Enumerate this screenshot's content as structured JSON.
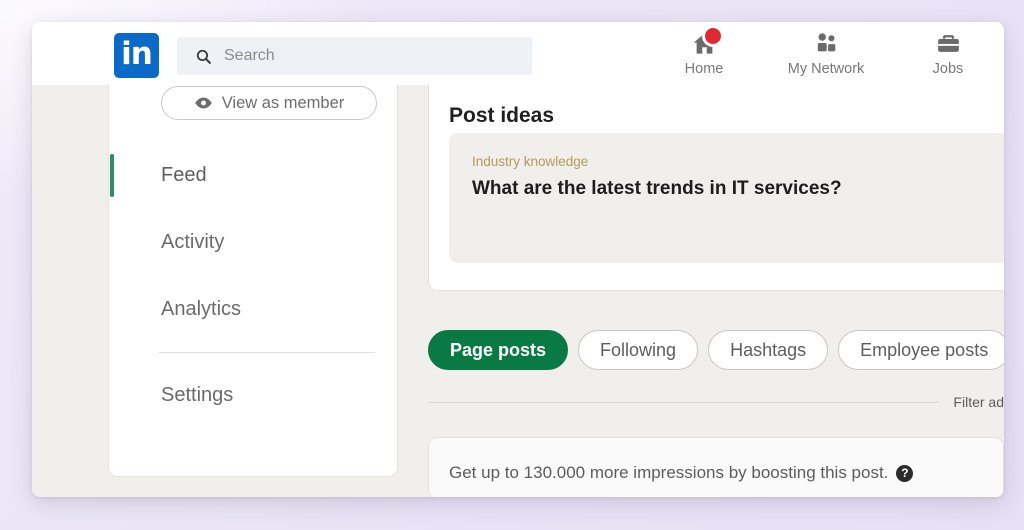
{
  "brand": {
    "logo_text": "in",
    "logo_color": "#0b69c7",
    "accent_green": "#0a7a45",
    "badge_red": "#dd2a32",
    "category_gold": "#b49a5d"
  },
  "search": {
    "placeholder": "Search",
    "icon": "search-icon"
  },
  "topnav": {
    "items": [
      {
        "label": "Home",
        "icon": "home-icon",
        "has_badge": true
      },
      {
        "label": "My Network",
        "icon": "people-icon",
        "has_badge": false
      },
      {
        "label": "Jobs",
        "icon": "briefcase-icon",
        "has_badge": false
      }
    ]
  },
  "sidebar": {
    "view_as_member": {
      "label": "View as member",
      "icon": "eye-icon"
    },
    "items": [
      {
        "label": "Feed",
        "active": true
      },
      {
        "label": "Activity",
        "active": false
      },
      {
        "label": "Analytics",
        "active": false
      },
      {
        "label": "Settings",
        "active": false
      }
    ]
  },
  "main": {
    "post_ideas": {
      "title": "Post ideas",
      "idea": {
        "category": "Industry knowledge",
        "question": "What are the latest trends in IT services?"
      }
    },
    "pills": [
      {
        "label": "Page posts",
        "active": true
      },
      {
        "label": "Following",
        "active": false
      },
      {
        "label": "Hashtags",
        "active": false
      },
      {
        "label": "Employee posts",
        "active": false
      }
    ],
    "filter_row": {
      "filter_ads_label": "Filter ad"
    },
    "boost_card": {
      "text": "Get up to 130.000 more impressions by boosting this post.",
      "help_icon_glyph": "?"
    }
  }
}
